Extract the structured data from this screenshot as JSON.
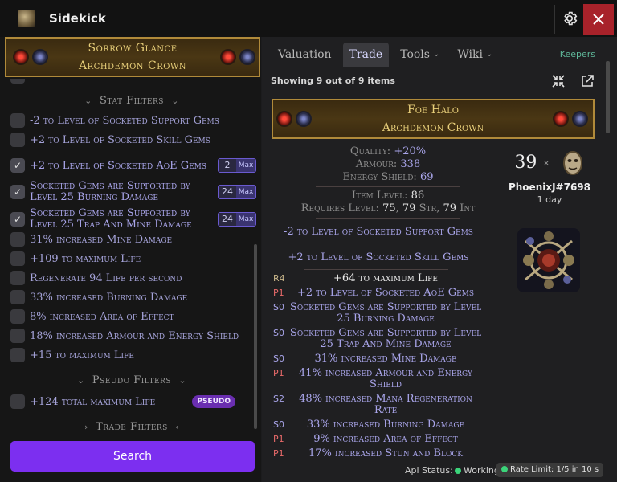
{
  "app": {
    "title": "Sidekick"
  },
  "item": {
    "name": "Sorrow Glance",
    "base": "Archdemon Crown"
  },
  "stat_filters": {
    "title": "Stat Filters",
    "rows": [
      {
        "text": "-2 to Level of Socketed Support Gems",
        "checked": false
      },
      {
        "text": "+2 to Level of Socketed Skill Gems",
        "checked": false
      },
      {
        "text": "+2 to Level of Socketed AoE Gems",
        "checked": true,
        "value": "2",
        "max": "Max"
      },
      {
        "text": "Socketed Gems are Supported by Level 25 Burning Damage",
        "checked": true,
        "value": "24",
        "max": "Max"
      },
      {
        "text": "Socketed Gems are Supported by Level 25 Trap And Mine Damage",
        "checked": true,
        "value": "24",
        "max": "Max"
      },
      {
        "text": "31% increased Mine Damage",
        "checked": false
      },
      {
        "text": "+109 to maximum Life",
        "checked": false
      },
      {
        "text": "Regenerate 94 Life per second",
        "checked": false
      },
      {
        "text": "33% increased Burning Damage",
        "checked": false
      },
      {
        "text": "8% increased Area of Effect",
        "checked": false
      },
      {
        "text": "18% increased Armour and Energy Shield",
        "checked": false
      },
      {
        "text": "+15 to maximum Life",
        "checked": false
      }
    ]
  },
  "pseudo_filters": {
    "title": "Pseudo Filters",
    "rows": [
      {
        "text": "+124 total maximum Life",
        "badge": "PSEUDO"
      }
    ]
  },
  "trade_filters": {
    "title": "Trade Filters"
  },
  "search_button": "Search",
  "tabs": [
    {
      "label": "Valuation"
    },
    {
      "label": "Trade"
    },
    {
      "label": "Tools"
    },
    {
      "label": "Wiki"
    }
  ],
  "keepers_label": "Keepers",
  "results": {
    "showing": "Showing 9 out of 9 items"
  },
  "listing": {
    "name": "Foe Halo",
    "base": "Archdemon Crown",
    "properties": {
      "quality_label": "Quality:",
      "quality": "+20%",
      "armour_label": "Armour:",
      "armour": "338",
      "es_label": "Energy Shield:",
      "es": "69",
      "ilvl_label": "Item Level:",
      "ilvl": "86",
      "req_label": "Requires Level:",
      "req_level": "75",
      "req_str": "79",
      "str_label": "Str,",
      "req_int": "79",
      "int_label": "Int"
    },
    "implicits": [
      "-2 to Level of Socketed Support Gems",
      "+2 to Level of Socketed Skill Gems"
    ],
    "mods": [
      {
        "tag": "R4",
        "text": "+64 to maximum Life"
      },
      {
        "tag": "P1",
        "text": "+2 to Level of Socketed AoE Gems"
      },
      {
        "tag": "S0",
        "text": "Socketed Gems are Supported by Level 25 Burning Damage"
      },
      {
        "tag": "S0",
        "text": "Socketed Gems are Supported by Level 25 Trap And Mine Damage"
      },
      {
        "tag": "S0",
        "text": "31% increased Mine Damage"
      },
      {
        "tag": "P1",
        "text": "41% increased Armour and Energy Shield"
      },
      {
        "tag": "S2",
        "text": "48% increased Mana Regeneration Rate"
      },
      {
        "tag": "S0",
        "text": "33% increased Burning Damage"
      },
      {
        "tag": "P1",
        "text": "9% increased Area of Effect"
      },
      {
        "tag": "P1",
        "text": "17% increased Stun and Block"
      }
    ],
    "price": "39",
    "price_x": "×",
    "seller": "PhoenixJ#7698",
    "listed": "1 day"
  },
  "status": {
    "label": "Api Status:",
    "value": "Working",
    "rate_limit": "Rate Limit: 1/5 in 10 s"
  },
  "colors": {
    "accent": "#7c2ff0",
    "close": "#a8222a",
    "magic": "#a9a5ea",
    "unique_gold": "#e8cf7a"
  }
}
